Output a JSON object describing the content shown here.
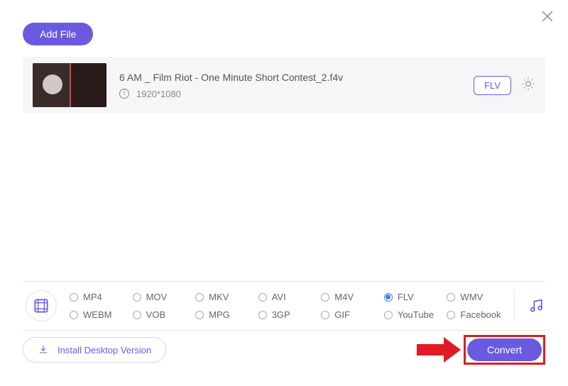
{
  "header": {
    "add_file_label": "Add File"
  },
  "file": {
    "name": "6 AM _ Film Riot - One Minute Short Contest_2.f4v",
    "resolution": "1920*1080",
    "output_format": "FLV"
  },
  "formats": {
    "options": [
      {
        "label": "MP4",
        "selected": false
      },
      {
        "label": "MOV",
        "selected": false
      },
      {
        "label": "MKV",
        "selected": false
      },
      {
        "label": "AVI",
        "selected": false
      },
      {
        "label": "M4V",
        "selected": false
      },
      {
        "label": "FLV",
        "selected": true
      },
      {
        "label": "WMV",
        "selected": false
      },
      {
        "label": "WEBM",
        "selected": false
      },
      {
        "label": "VOB",
        "selected": false
      },
      {
        "label": "MPG",
        "selected": false
      },
      {
        "label": "3GP",
        "selected": false
      },
      {
        "label": "GIF",
        "selected": false
      },
      {
        "label": "YouTube",
        "selected": false
      },
      {
        "label": "Facebook",
        "selected": false
      }
    ]
  },
  "footer": {
    "install_label": "Install Desktop Version",
    "convert_label": "Convert"
  }
}
